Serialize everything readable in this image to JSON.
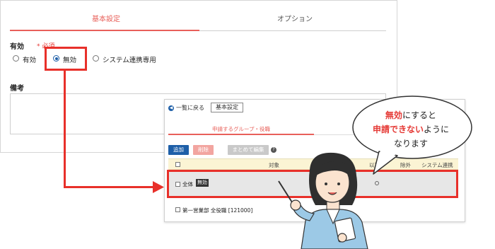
{
  "settings_form": {
    "tabs": {
      "basic": "基本設定",
      "options": "オプション"
    },
    "enabled_label": "有効",
    "required_mark": "* 必須",
    "radio_options": [
      {
        "label": "有効",
        "selected": false
      },
      {
        "label": "無効",
        "selected": true
      },
      {
        "label": "システム連携専用",
        "selected": false
      }
    ],
    "notes_label": "備考",
    "notes_value": ""
  },
  "group_list": {
    "back_link": "一覧に戻る",
    "basic_settings_button": "基本設定",
    "tab_label": "申請するグループ・役職",
    "toolbar": {
      "add": "追加",
      "delete": "削除",
      "bulk_edit": "まとめて編集"
    },
    "columns": {
      "target": "対象",
      "exclude": "除外",
      "system_link": "システム連携"
    },
    "column_target_suffix": "以下",
    "rows": [
      {
        "target": "全体",
        "badge": "無効"
      },
      {
        "target": "第一営業部 全役職 [121000]",
        "badge": ""
      }
    ]
  },
  "callout": {
    "line1_highlight": "無効",
    "line1_rest": "にすると",
    "line2_highlight": "申請できない",
    "line2_rest": "ように",
    "line3": "なります"
  },
  "colors": {
    "accent": "#e8605a",
    "highlight": "#e8302a",
    "primary": "#1e5fa8"
  }
}
